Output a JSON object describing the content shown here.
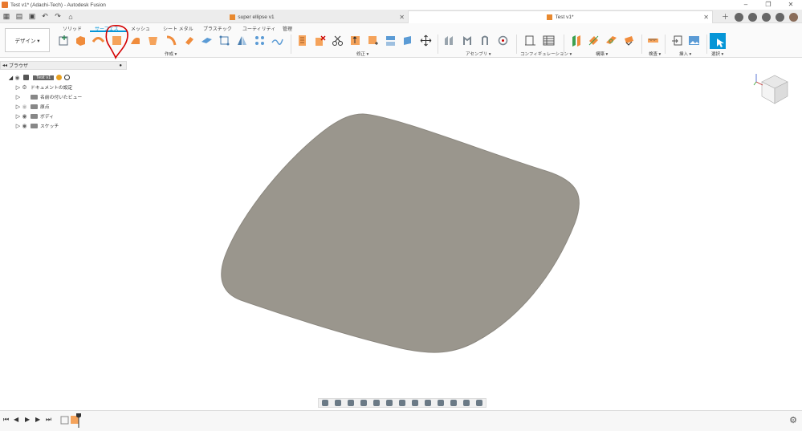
{
  "window": {
    "title": "Test v1* (Adachi-Tech) - Autodesk Fusion",
    "controls": [
      "–",
      "❐",
      "✕"
    ]
  },
  "tabs": [
    {
      "label": "super ellipse v1",
      "active": false
    },
    {
      "label": "Test v1*",
      "active": true
    }
  ],
  "toolbar": {
    "workspace_label": "デザイン ▾",
    "tabs": [
      "ソリッド",
      "サーフェス",
      "メッシュ",
      "シート メタル",
      "プラスチック",
      "ユーティリティ",
      "管理"
    ],
    "selected_tab": "サーフェス",
    "groups": [
      "作成 ▾",
      "修正 ▾",
      "アセンブリ ▾",
      "コンフィギュレーション ▾",
      "構築 ▾",
      "検査 ▾",
      "挿入 ▾",
      "選択 ▾"
    ]
  },
  "browser": {
    "title": "ブラウザ",
    "root": "Test v1",
    "items": [
      "ドキュメントの設定",
      "名前の付いたビュー",
      "原点",
      "ボディ",
      "スケッチ"
    ]
  },
  "colors": {
    "accent": "#0696d7",
    "surface": "#9a968d",
    "annotation": "#d40000",
    "icon_orange": "#f5a35b"
  }
}
